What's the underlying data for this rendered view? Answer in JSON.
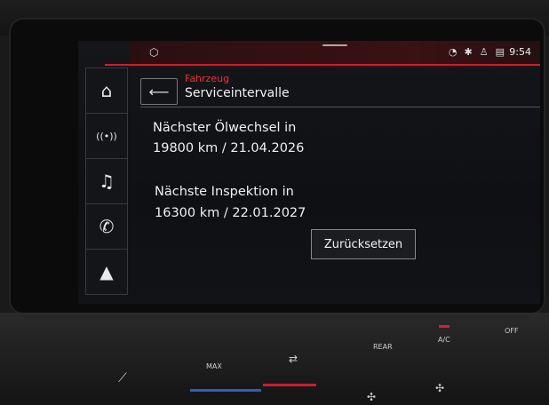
{
  "status": {
    "time": "9:54",
    "icons": [
      "wifi-icon",
      "bluetooth-icon",
      "person-icon",
      "signal-icon"
    ],
    "left_icon": "settings-cube-icon"
  },
  "sidebar": {
    "items": [
      {
        "name": "home-icon",
        "glyph": "⌂"
      },
      {
        "name": "radio-icon",
        "glyph": "((•))"
      },
      {
        "name": "music-icon",
        "glyph": "♫"
      },
      {
        "name": "phone-icon",
        "glyph": "✆"
      },
      {
        "name": "navigation-icon",
        "glyph": "▲"
      }
    ]
  },
  "header": {
    "breadcrumb": "Fahrzeug",
    "title": "Serviceintervalle",
    "back_glyph": "⟵"
  },
  "content": {
    "oil_label": "Nächster Ölwechsel in",
    "oil_value": "19800 km / 21.04.2026",
    "inspection_label": "Nächste Inspektion in",
    "inspection_value": "16300 km / 22.01.2027",
    "reset_button": "Zurücksetzen"
  },
  "console": {
    "max_label": "MAX",
    "rear_label": "REAR",
    "ac_label": "A/C",
    "off_label": "OFF"
  },
  "colors": {
    "accent_red": "#e33333",
    "status_bar": "#3a1114"
  }
}
